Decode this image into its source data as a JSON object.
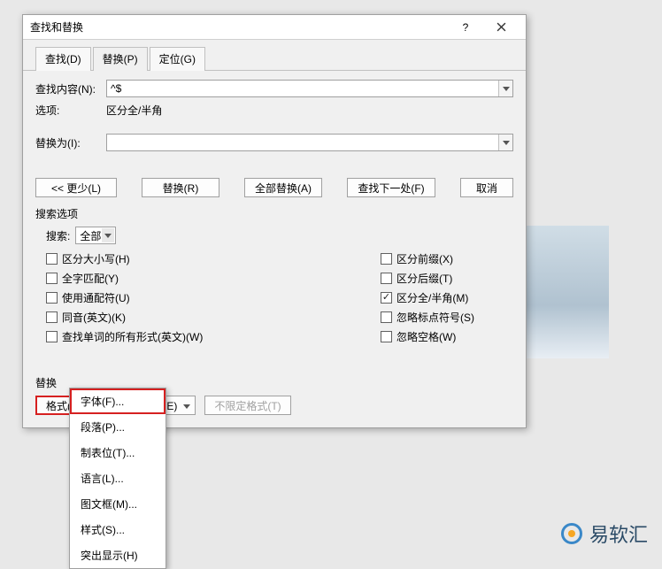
{
  "dialog": {
    "title": "查找和替换",
    "help": "?",
    "tabs": {
      "find": "查找(D)",
      "replace": "替换(P)",
      "goto": "定位(G)"
    },
    "find_label": "查找内容(N):",
    "find_value": "^$",
    "options_label": "选项:",
    "options_value": "区分全/半角",
    "replace_label": "替换为(I):",
    "replace_value": "",
    "buttons": {
      "less": "<< 更少(L)",
      "replace": "替换(R)",
      "replace_all": "全部替换(A)",
      "find_next": "查找下一处(F)",
      "cancel": "取消"
    },
    "search_options_title": "搜索选项",
    "search_label": "搜索:",
    "search_value": "全部",
    "checks_left": [
      {
        "label": "区分大小写(H)",
        "checked": false
      },
      {
        "label": "全字匹配(Y)",
        "checked": false
      },
      {
        "label": "使用通配符(U)",
        "checked": false
      },
      {
        "label": "同音(英文)(K)",
        "checked": false
      },
      {
        "label": "查找单词的所有形式(英文)(W)",
        "checked": false
      }
    ],
    "checks_right": [
      {
        "label": "区分前缀(X)",
        "checked": false
      },
      {
        "label": "区分后缀(T)",
        "checked": false
      },
      {
        "label": "区分全/半角(M)",
        "checked": true
      },
      {
        "label": "忽略标点符号(S)",
        "checked": false
      },
      {
        "label": "忽略空格(W)",
        "checked": false
      }
    ],
    "replace_section_title": "替换",
    "format_btn": "格式(O)",
    "special_btn": "特殊格式(E)",
    "no_format_btn": "不限定格式(T)"
  },
  "menu": {
    "items": [
      "字体(F)...",
      "段落(P)...",
      "制表位(T)...",
      "语言(L)...",
      "图文框(M)...",
      "样式(S)...",
      "突出显示(H)"
    ]
  },
  "watermark": "易软汇"
}
